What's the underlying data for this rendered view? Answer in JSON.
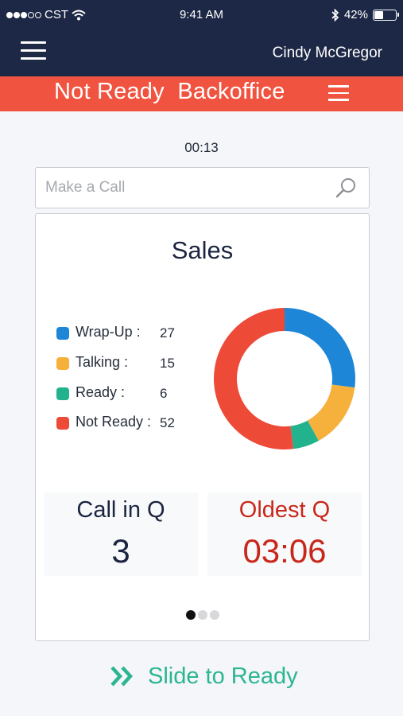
{
  "status_bar": {
    "carrier": "CST",
    "time": "9:41 AM",
    "battery": "42%",
    "battery_level": 0.42
  },
  "header": {
    "menu_icon": "hamburger-menu-icon",
    "user_name": "Cindy McGregor"
  },
  "state_bar": {
    "status": "Not Ready  Backoffice",
    "menu_icon": "hamburger-menu-icon",
    "color": "#f0533f"
  },
  "timer": "00:13",
  "search": {
    "placeholder": "Make a Call",
    "value": "",
    "icon": "search-icon"
  },
  "card": {
    "title": "Sales",
    "legend": [
      {
        "label": "Wrap-Up :",
        "value": "27",
        "color": "#1e86d6"
      },
      {
        "label": "Talking :",
        "value": "15",
        "color": "#f5b13b"
      },
      {
        "label": "Ready :",
        "value": "6",
        "color": "#22b38e"
      },
      {
        "label": "Not Ready :",
        "value": "52",
        "color": "#ee4a38"
      }
    ],
    "call_in_q": {
      "label": "Call in Q",
      "value": "3",
      "color": "#1b2440"
    },
    "oldest_q": {
      "label": "Oldest Q",
      "value": "03:06",
      "color": "#c8281b"
    },
    "pager": {
      "total": 3,
      "active": 1
    }
  },
  "slide": {
    "label": "Slide to Ready",
    "icon": "double-chevron-right-icon",
    "color": "#2cb592"
  },
  "chart_data": {
    "type": "pie",
    "categories": [
      "Wrap-Up",
      "Talking",
      "Ready",
      "Not Ready"
    ],
    "values": [
      27,
      15,
      6,
      52
    ],
    "colors": [
      "#1e86d6",
      "#f5b13b",
      "#22b38e",
      "#ee4a38"
    ],
    "title": "Sales",
    "donut": true
  }
}
